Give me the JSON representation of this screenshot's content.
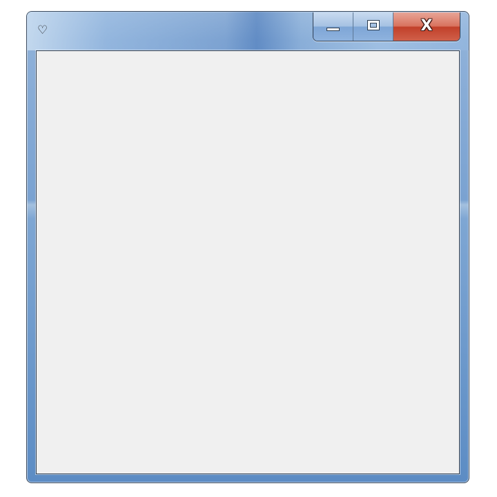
{
  "window": {
    "icon": "heart-icon",
    "icon_glyph": "♡",
    "title": ""
  },
  "caption_buttons": {
    "minimize_icon": "minimize-icon",
    "maximize_icon": "maximize-icon",
    "close_icon": "close-icon",
    "close_glyph": "X"
  },
  "client_area": {
    "content": ""
  },
  "colors": {
    "frame_accent": "#7aa2d1",
    "close_button": "#c1402a",
    "client_background": "#f0f0f0"
  }
}
